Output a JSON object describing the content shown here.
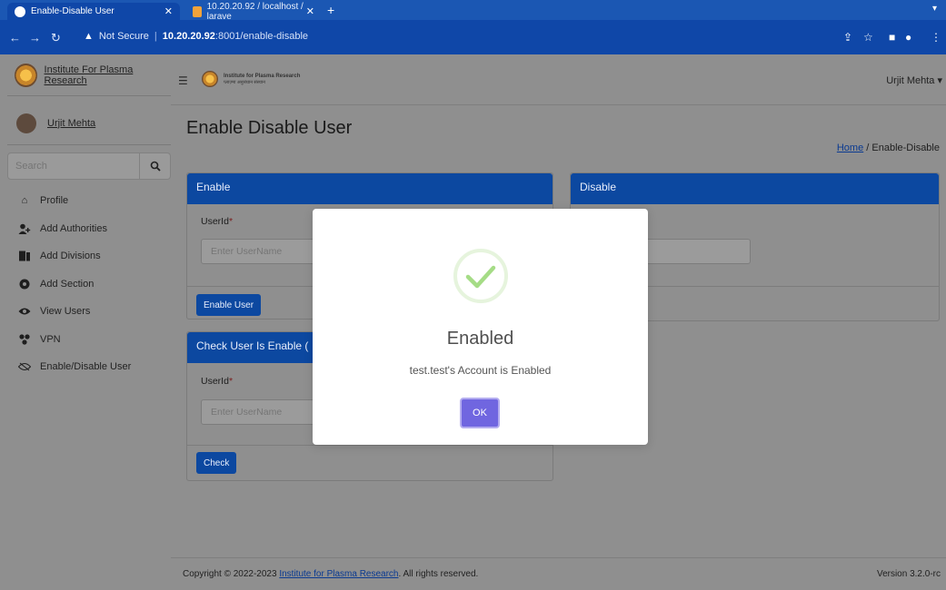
{
  "browser": {
    "tabs": [
      {
        "label": "Enable-Disable User",
        "active": true
      },
      {
        "label": "10.20.20.92 / localhost / larave",
        "active": false
      }
    ],
    "new_tab": "+",
    "address": {
      "security": "Not Secure",
      "host": "10.20.20.92",
      "path": ":8001/enable-disable"
    }
  },
  "sidebar": {
    "brand": "Institute For Plasma Research",
    "user": "Urjit Mehta",
    "search_placeholder": "Search",
    "items": [
      {
        "label": "Profile",
        "icon": "home-icon"
      },
      {
        "label": "Add Authorities",
        "icon": "user-plus-icon"
      },
      {
        "label": "Add Divisions",
        "icon": "door-icon"
      },
      {
        "label": "Add Section",
        "icon": "gear-icon"
      },
      {
        "label": "View Users",
        "icon": "eye-icon"
      },
      {
        "label": "VPN",
        "icon": "network-icon"
      },
      {
        "label": "Enable/Disable User",
        "icon": "eye-slash-icon"
      }
    ]
  },
  "topbar": {
    "logo_line1": "Institute for Plasma Research",
    "logo_line2": "प्लाज़्मा अनुसंधान संस्थान",
    "user": "Urjit Mehta"
  },
  "main": {
    "title": "Enable Disable User",
    "breadcrumb": {
      "home": "Home",
      "sep": "/",
      "current": "Enable-Disable"
    },
    "enable_card": {
      "title": "Enable",
      "label": "UserId",
      "required": "*",
      "placeholder": "Enter UserName",
      "button": "Enable User"
    },
    "disable_card": {
      "title": "Disable",
      "placeholder_visible": "ame"
    },
    "check_card": {
      "title": "Check User Is Enable (",
      "label": "UserId",
      "required": "*",
      "placeholder": "Enter UserName",
      "button": "Check"
    }
  },
  "footer": {
    "copyright_prefix": "Copyright © 2022-2023 ",
    "org_link": "Institute for Plasma Research",
    "copyright_suffix": ". All rights reserved.",
    "version": "Version 3.2.0-rc"
  },
  "modal": {
    "title": "Enabled",
    "message": "test.test's Account is Enabled",
    "ok": "OK",
    "colors": {
      "success": "#a5dc86",
      "ok_button": "#7066e0"
    }
  }
}
